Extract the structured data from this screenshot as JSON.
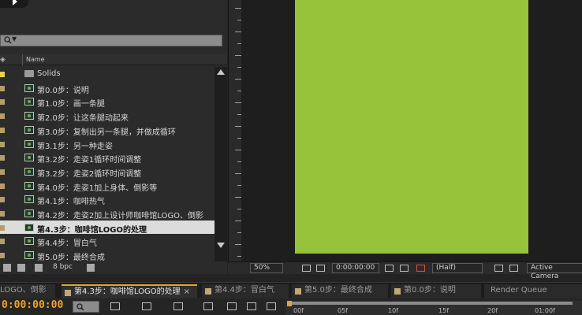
{
  "project": {
    "search_placeholder": "",
    "header_name": "Name",
    "items": [
      {
        "label": "Solids",
        "type": "folder"
      },
      {
        "label": "第0.0步：说明",
        "type": "comp"
      },
      {
        "label": "第1.0步：画一条腿",
        "type": "comp"
      },
      {
        "label": "第2.0步：让这条腿动起来",
        "type": "comp"
      },
      {
        "label": "第3.0步：复制出另一条腿，并做成循环",
        "type": "comp"
      },
      {
        "label": "第3.1步：另一种走姿",
        "type": "comp"
      },
      {
        "label": "第3.2步：走姿1循环时间调整",
        "type": "comp"
      },
      {
        "label": "第3.2步：走姿2循环时间调整",
        "type": "comp"
      },
      {
        "label": "第4.0步：走姿1加上身体、倒影等",
        "type": "comp"
      },
      {
        "label": "第4.1步：咖啡热气",
        "type": "comp"
      },
      {
        "label": "第4.2步：走姿2加上设计师咖啡馆LOGO、倒影",
        "type": "comp"
      },
      {
        "label": "第4.3步：咖啡馆LOGO的处理",
        "type": "comp",
        "selected": true
      },
      {
        "label": "第4.4步：冒白气",
        "type": "comp"
      },
      {
        "label": "第5.0步：最终合成",
        "type": "comp"
      }
    ],
    "bpc_label": "8 bpc"
  },
  "viewer": {
    "zoom": "50%",
    "timecode": "0:00:00:00",
    "resolution": "(Half)",
    "camera": "Active Camera",
    "canvas_color": "#97c33a"
  },
  "tabs": [
    {
      "label": "LOGO、倒影"
    },
    {
      "label": "第4.3步：咖啡馆LOGO的处理",
      "active": true,
      "close": "×"
    },
    {
      "label": "第4.4步：冒白气"
    },
    {
      "label": "第5.0步：最终合成"
    },
    {
      "label": "第0.0步：说明"
    },
    {
      "label": "Render Queue"
    }
  ],
  "timeline": {
    "timecode": "0:00:00:00",
    "ruler_labels": [
      "00f",
      "05f",
      "10f",
      "15f",
      "20f",
      "01:00f"
    ],
    "accent_color": "#f2a128"
  }
}
